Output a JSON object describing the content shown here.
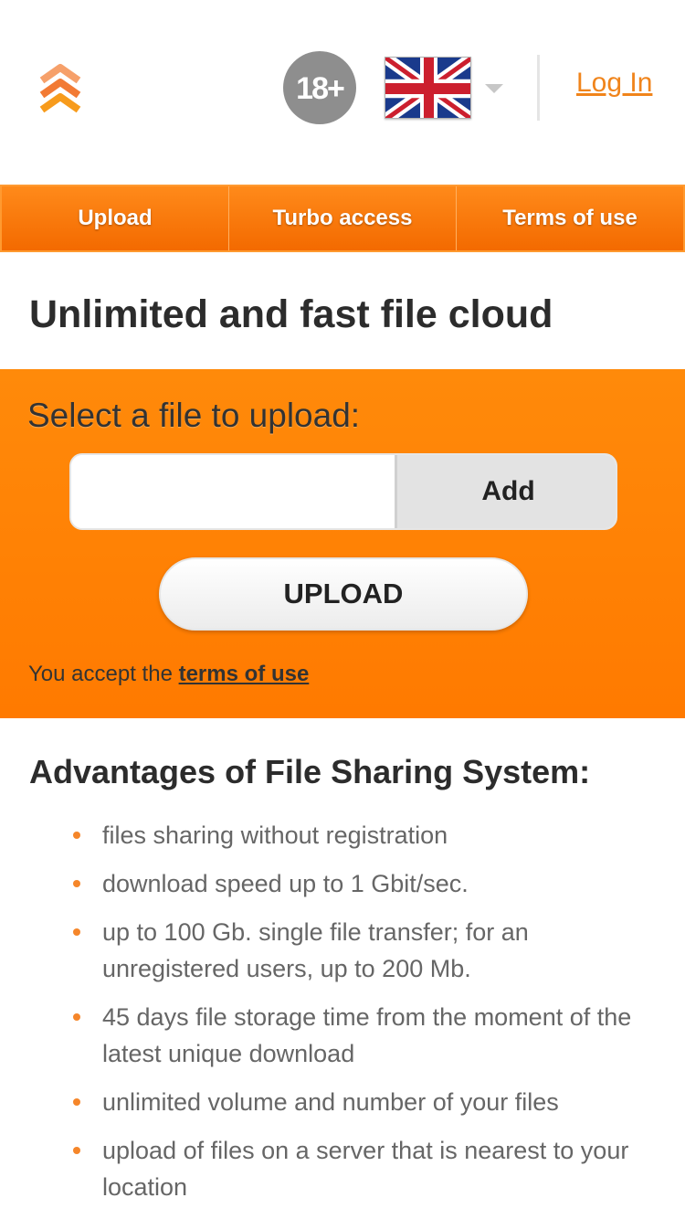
{
  "header": {
    "age_badge": "18+",
    "language_icon": "uk-flag-icon",
    "login_label": "Log In"
  },
  "nav": {
    "items": [
      {
        "label": "Upload"
      },
      {
        "label": "Turbo access"
      },
      {
        "label": "Terms of use"
      }
    ]
  },
  "main": {
    "title": "Unlimited and fast file cloud"
  },
  "upload": {
    "label": "Select a file to upload:",
    "file_value": "",
    "add_label": "Add",
    "upload_label": "UPLOAD",
    "terms_prefix": "You accept the",
    "terms_link": "terms of use"
  },
  "advantages": {
    "title": "Advantages of File Sharing System:",
    "items": [
      "files sharing without registration",
      "download speed up to 1 Gbit/sec.",
      "up to 100 Gb. single file transfer; for an unregistered users, up to 200 Mb.",
      "45 days file storage time from the moment of the latest unique download",
      "unlimited volume and number of your files",
      "upload of files on a server that is nearest to your location"
    ]
  },
  "colors": {
    "accent": "#ff7f00",
    "link": "#f0841b",
    "bullet": "#f5862a"
  }
}
